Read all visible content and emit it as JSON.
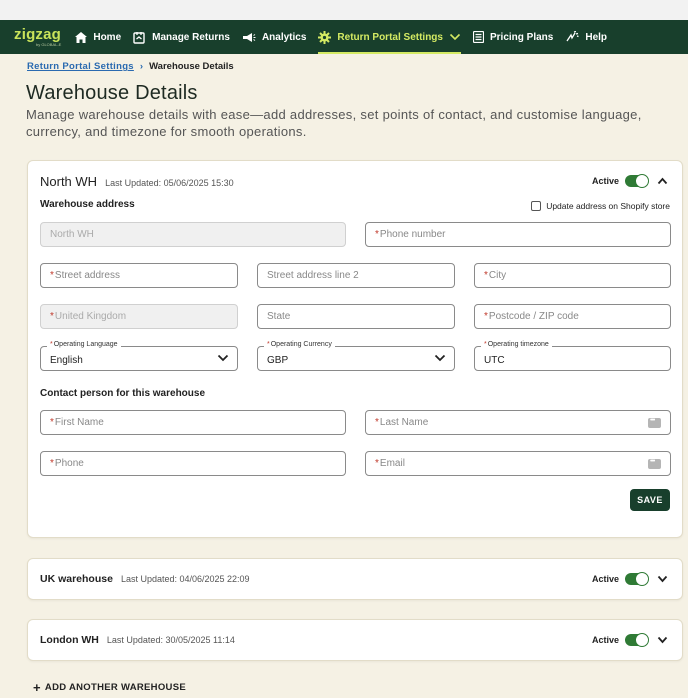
{
  "nav": {
    "brand": "zigzag",
    "brand_sub": "by GLOBAL-E",
    "items": [
      {
        "label": "Home",
        "icon": "home-icon"
      },
      {
        "label": "Manage Returns",
        "icon": "returns-icon"
      },
      {
        "label": "Analytics",
        "icon": "megaphone-icon"
      },
      {
        "label": "Return Portal Settings",
        "icon": "gear-icon",
        "active": true
      },
      {
        "label": "Pricing Plans",
        "icon": "document-icon"
      },
      {
        "label": "Help",
        "icon": "wave-icon"
      }
    ]
  },
  "breadcrumb": {
    "parent": "Return Portal Settings",
    "current": "Warehouse Details"
  },
  "page": {
    "title": "Warehouse Details",
    "subtitle": "Manage warehouse details with ease—add addresses, set points of contact, and customise language, currency, and timezone for smooth operations."
  },
  "warehouses": [
    {
      "name": "North WH",
      "updated": "Last Updated: 05/06/2025 15:30",
      "active_label": "Active",
      "address_section": "Warehouse address",
      "shopify_label": "Update address on Shopify store",
      "fields": {
        "name_value": "North WH",
        "phone_ph": "Phone number",
        "street_ph": "Street address",
        "street2_ph": "Street address line 2",
        "city_ph": "City",
        "country_value": "United Kingdom",
        "state_ph": "State",
        "postcode_ph": "Postcode / ZIP code",
        "language_label": "Operating Language",
        "language_value": "English",
        "currency_label": "Operating Currency",
        "currency_value": "GBP",
        "timezone_label": "Operating timezone",
        "timezone_value": "UTC"
      },
      "contact_section": "Contact person for this warehouse",
      "contact": {
        "first_ph": "First Name",
        "last_ph": "Last Name",
        "phone_ph": "Phone",
        "email_ph": "Email"
      },
      "save_label": "SAVE"
    },
    {
      "name": "UK warehouse",
      "updated": "Last Updated: 04/06/2025 22:09",
      "active_label": "Active"
    },
    {
      "name": "London WH",
      "updated": "Last Updated: 30/05/2025 11:14",
      "active_label": "Active"
    }
  ],
  "add_label": "ADD ANOTHER WAREHOUSE",
  "colors": {
    "nav_bg": "#183f2c",
    "accent": "#d4ea63",
    "toggle": "#2f7a35",
    "page_bg": "#f5f1e4"
  }
}
